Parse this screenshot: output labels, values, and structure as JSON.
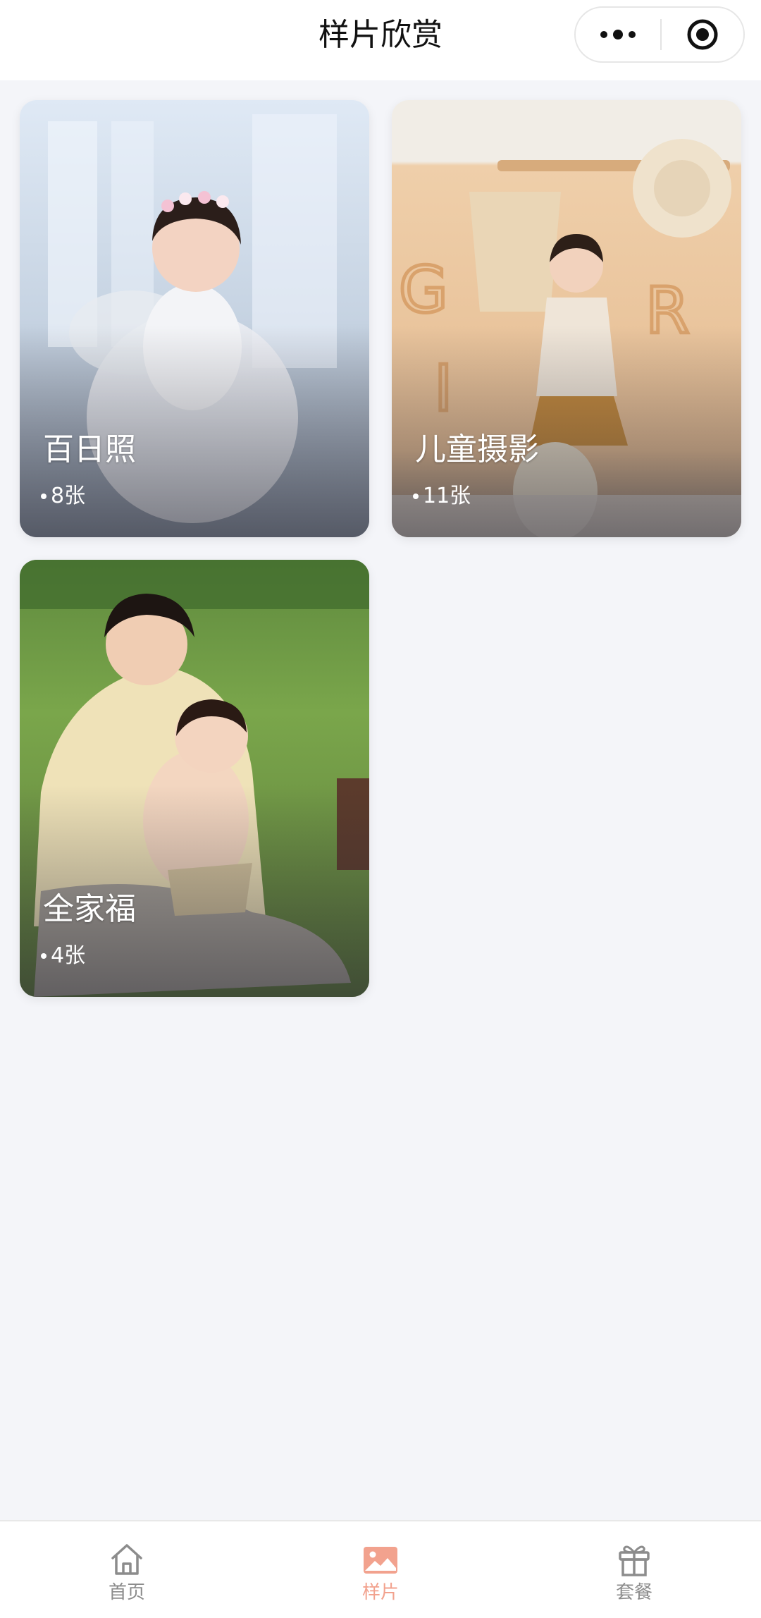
{
  "navbar": {
    "title": "样片欣赏",
    "more_icon": "more-dots-icon",
    "close_icon": "target-close-icon"
  },
  "albums": [
    {
      "title": "百日照",
      "count": "8张",
      "icon": "photo-cover"
    },
    {
      "title": "儿童摄影",
      "count": "11张",
      "icon": "photo-cover"
    },
    {
      "title": "全家福",
      "count": "4张",
      "icon": "photo-cover"
    }
  ],
  "tabbar": {
    "tabs": [
      {
        "label": "首页",
        "icon": "home-icon",
        "active": false
      },
      {
        "label": "样片",
        "icon": "image-icon",
        "active": true
      },
      {
        "label": "套餐",
        "icon": "gift-icon",
        "active": false
      }
    ],
    "active_color": "#f2a28e",
    "inactive_color": "#8c8c8c"
  }
}
